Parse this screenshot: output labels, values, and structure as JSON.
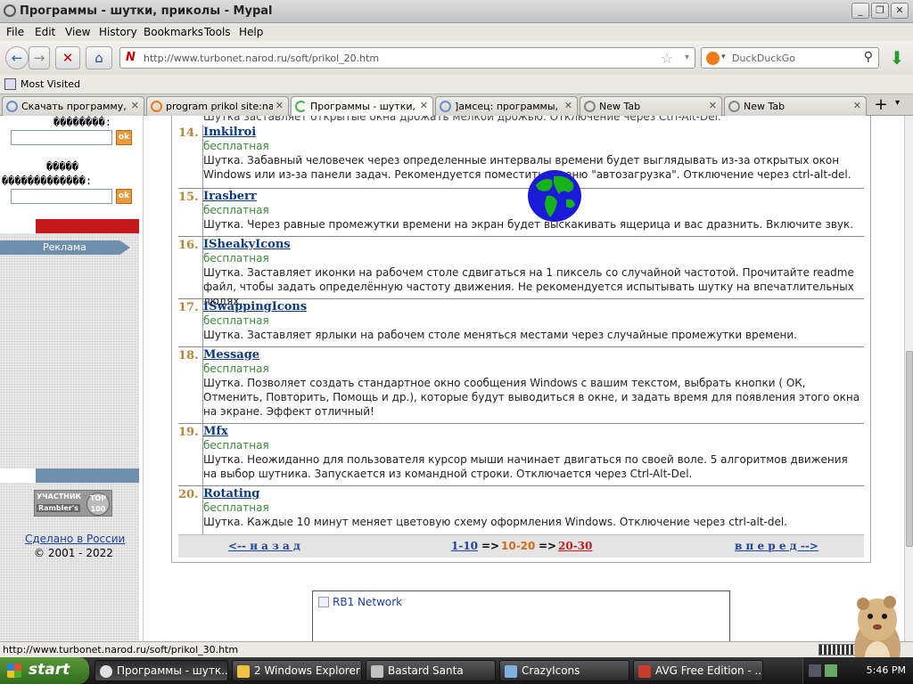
{
  "window": {
    "title": "Программы - шутки, приколы - Mypal",
    "minimize": "_",
    "maximize": "❐",
    "close": "✕"
  },
  "menu": [
    "File",
    "Edit",
    "View",
    "History",
    "Bookmarks",
    "Tools",
    "Help"
  ],
  "nav": {
    "back": "←",
    "forward": "→",
    "stop": "✕",
    "home": "⌂",
    "url": "http://www.turbonet.narod.ru/soft/prikol_20.htm",
    "site_glyph": "N",
    "star": "☆",
    "dropdown": "▾",
    "search_placeholder": "DuckDuckGo",
    "search_glyph": "⚲",
    "download": "⬇"
  },
  "bookmarks": {
    "most_visited": "Most Visited"
  },
  "tabs": [
    {
      "label": "Скачать программу, ...",
      "active": false
    },
    {
      "label": "program prikol site:nar...",
      "active": false
    },
    {
      "label": "Программы - шутки, ...",
      "active": true
    },
    {
      "label": "]амсец: программы, ...",
      "active": false
    },
    {
      "label": "New Tab",
      "active": false
    },
    {
      "label": "New Tab",
      "active": false
    }
  ],
  "tab_close": "✕",
  "new_tab": "+",
  "tab_list": "▾",
  "sidebar": {
    "garbled1": "��������:",
    "garbled2": "�����",
    "garbled3": "�������������:",
    "ok": "ok",
    "ad_label": "Реклама",
    "badge_line1": "УЧАСТНИК",
    "badge_line2": "Rambler's",
    "badge_top": "TOP 100",
    "made_in": "Сделано в России",
    "copyright": "© 2001 - 2022"
  },
  "top_snippet": "Шутка заставляет открытые окна дрожать мелкой дрожью. Отключение через Ctrl-Alt-Del.",
  "items": [
    {
      "num": "14.",
      "name": "Imkilroi",
      "price": "бесплатная",
      "desc": "Шутка. Забавный человечек через определенные интервалы времени будет выглядывать из-за открытых окон Windows или из-за панели задач. Рекомендуется поместить в меню \"автозагрузка\". Отключение через ctrl-alt-del."
    },
    {
      "num": "15.",
      "name": "Irasberr",
      "price": "бесплатная",
      "desc": "Шутка. Через равные промежутки времени на экран будет выскакивать ящерица и вас дразнить. Включите звук."
    },
    {
      "num": "16.",
      "name": "ISheakyIcons",
      "price": "бесплатная",
      "desc": "Шутка. Заставляет иконки на рабочем столе сдвигаться на 1 пиксель со случайной частотой. Прочитайте readme файл, чтобы задать определённую частоту движения. Не рекомендуется испытывать шутку на впечатлительных людях."
    },
    {
      "num": "17.",
      "name": "ISwappingIcons",
      "price": "бесплатная",
      "desc": "Шутка. Заставляет ярлыки на рабочем столе меняться местами через случайные промежутки времени."
    },
    {
      "num": "18.",
      "name": "Message",
      "price": "бесплатная",
      "desc": "Шутка. Позволяет создать стандартное окно сообщения Windows с вашим текстом, выбрать кнопки ( ОК, Отменить, Повторить, Помощь и др.), которые будут выводиться в окне, и задать время для появления этого окна на экране. Эффект отличный!"
    },
    {
      "num": "19.",
      "name": "Mfx",
      "price": "бесплатная",
      "desc": "Шутка. Неожиданно для пользователя курсор мыши начинает двигаться по своей воле. 5 алгоритмов движения на выбор шутника. Запускается из командной строки. Отключается через Ctrl-Alt-Del."
    },
    {
      "num": "20.",
      "name": "Rotating",
      "price": "бесплатная",
      "desc": "Шутка. Каждые 10 минут меняет цветовую схему оформления Windows. Отключение через ctrl-alt-del."
    }
  ],
  "pager": {
    "back": "<-- н а з а д",
    "p1": "1-10",
    "arrow1": "=>",
    "p2": "10-20",
    "arrow2": "=>",
    "p3": "20-30",
    "forward": "в п е р е д -->",
    "colors": {
      "link": "#1a44a0",
      "current": "#d46a1a",
      "next": "#c41a1a"
    }
  },
  "rb1": "RB1 Network",
  "status": "http://www.turbonet.narod.ru/soft/prikol_30.htm",
  "taskbar": {
    "start": "start",
    "tasks": [
      {
        "label": "Программы - шутк...",
        "icon_color": "#e0e0e0",
        "active": true
      },
      {
        "label": "2 Windows Explorer",
        "icon_color": "#f0c040",
        "active": false
      },
      {
        "label": "Bastard Santa",
        "icon_color": "#c0c0c0",
        "active": false
      },
      {
        "label": "CrazyIcons",
        "icon_color": "#7fb0e0",
        "active": false
      },
      {
        "label": "AVG Free Edition - ...",
        "icon_color": "#c83a2a",
        "active": false
      }
    ],
    "clock": "5:46 PM"
  }
}
